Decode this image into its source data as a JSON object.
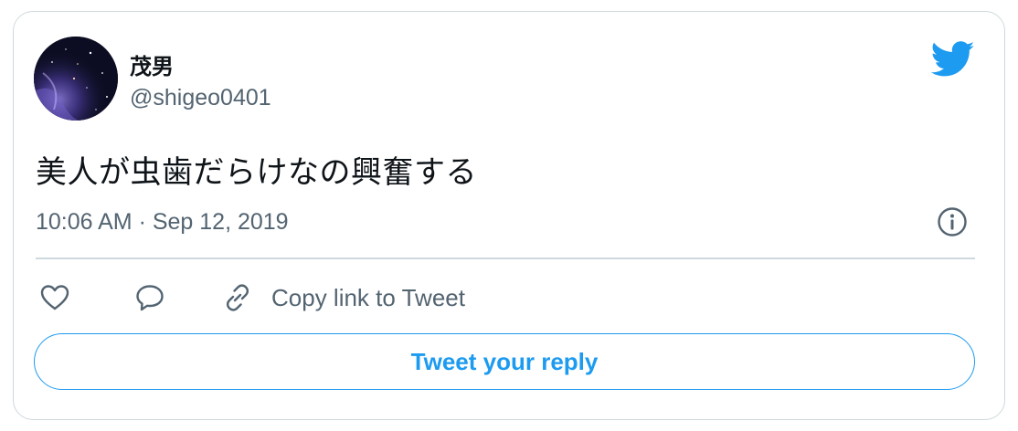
{
  "tweet": {
    "display_name": "茂男",
    "handle": "@shigeo0401",
    "text": "美人が虫歯だらけなの興奮する",
    "timestamp": "10:06 AM · Sep 12, 2019"
  },
  "actions": {
    "like_icon": "heart-icon",
    "reply_icon": "speech-bubble-icon",
    "copy_icon": "link-icon",
    "copy_label": "Copy link to Tweet"
  },
  "reply_button": {
    "label": "Tweet your reply"
  },
  "colors": {
    "accent": "#1d9bf0",
    "text": "#0f1419",
    "secondary": "#536471",
    "border": "#cfd9de"
  },
  "icons": {
    "brand": "twitter-bird-icon",
    "info": "info-icon"
  }
}
